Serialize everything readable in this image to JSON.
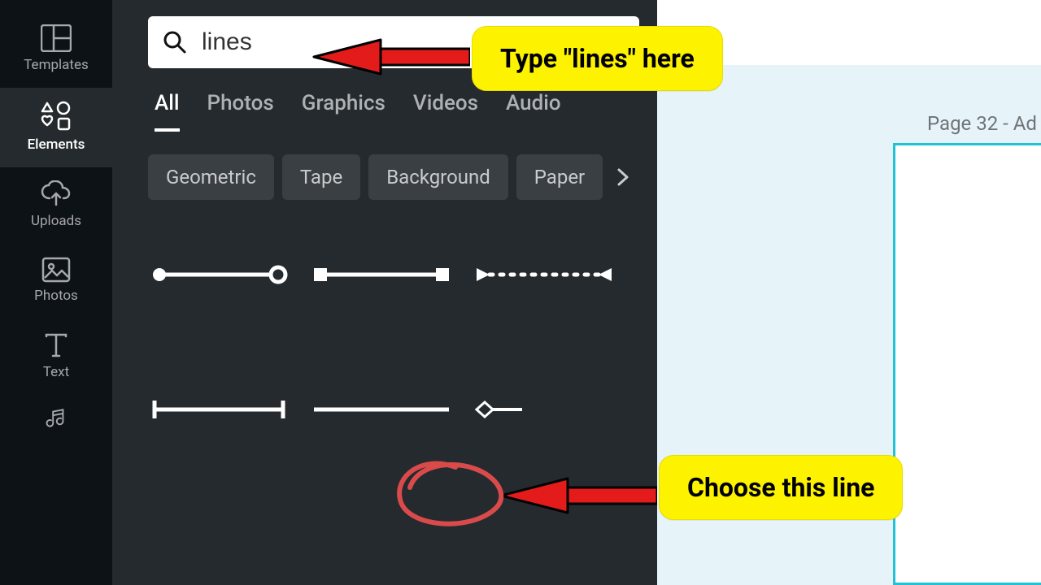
{
  "sidebar": {
    "items": [
      {
        "label": "Templates",
        "icon": "templates"
      },
      {
        "label": "Elements",
        "icon": "elements",
        "active": true
      },
      {
        "label": "Uploads",
        "icon": "uploads"
      },
      {
        "label": "Photos",
        "icon": "photos"
      },
      {
        "label": "Text",
        "icon": "text"
      },
      {
        "label": "",
        "icon": "audio"
      }
    ]
  },
  "search": {
    "value": "lines"
  },
  "tabs": [
    "All",
    "Photos",
    "Graphics",
    "Videos",
    "Audio"
  ],
  "active_tab": 0,
  "chips": [
    "Geometric",
    "Tape",
    "Background",
    "Paper"
  ],
  "page": {
    "label": "Page 32 - Ad"
  },
  "annotations": {
    "callout1": "Type \"lines\" here",
    "callout2": "Choose this line"
  },
  "results": {
    "row1": [
      "circle-ends",
      "square-ends",
      "dotted-arrows"
    ],
    "row2": [
      "tick-ends",
      "plain-line",
      "diamond-end"
    ]
  }
}
